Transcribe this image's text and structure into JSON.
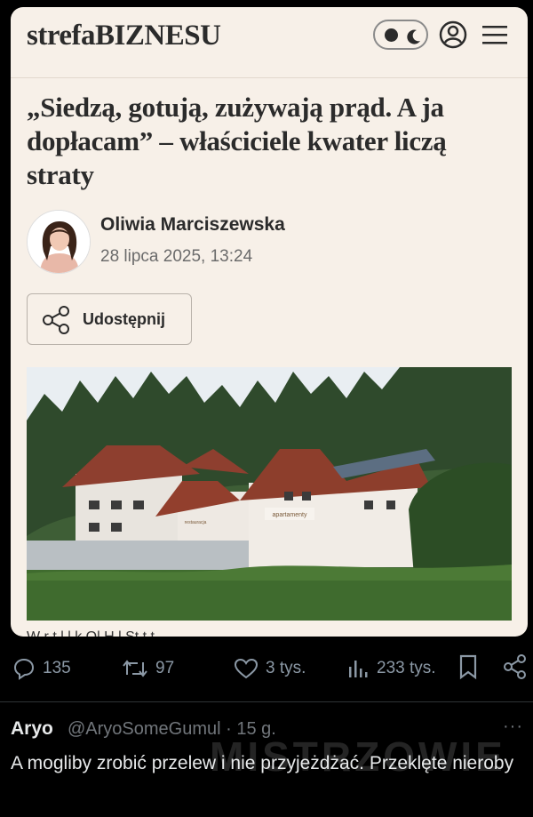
{
  "site": {
    "logo": "strefaBIZNESU"
  },
  "article": {
    "headline": "„Siedzą, gotują, zużywają prąd. A ja dopłacam” – właściciele kwater liczą straty",
    "author": "Oliwia Marciszewska",
    "date": "28 lipca 2025, 13:24",
    "share_label": "Udostępnij",
    "image_sign_1": "restauracja",
    "image_sign_2": "apartamenty",
    "caption_peek": "W r t  l  l   k   Ol    H  l  St t  t"
  },
  "tweet_actions": {
    "replies": "135",
    "reposts": "97",
    "likes": "3 tys.",
    "views": "233 tys."
  },
  "reply": {
    "name": "Aryo",
    "handle": "@AryoSomeGumul · 15 g.",
    "more": "···",
    "text": "A mogliby zrobić przelew i nie przyjeżdżać. Przeklęte nieroby"
  },
  "watermark": "MISTRZOWIE",
  "colors": {
    "card_bg": "#f7f0e8",
    "text_dark": "#2b2b2b",
    "muted": "#8b98a5",
    "background": "#000000"
  }
}
